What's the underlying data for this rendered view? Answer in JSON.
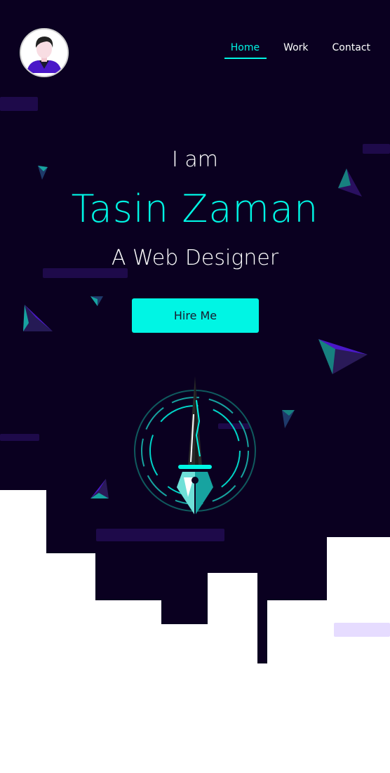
{
  "nav": {
    "items": [
      {
        "label": "Home",
        "active": true
      },
      {
        "label": "Work",
        "active": false
      },
      {
        "label": "Contact",
        "active": false
      }
    ]
  },
  "hero": {
    "intro": "I am",
    "name": "Tasin Zaman",
    "role": "A Web Designer",
    "cta_label": "Hire Me"
  },
  "icons": {
    "avatar": "user-avatar-icon",
    "illustration": "pen-nib-icon"
  },
  "colors": {
    "background": "#0a0020",
    "accent": "#00f5e4",
    "deco": "#1e0a4a",
    "text": "#ffffff"
  }
}
